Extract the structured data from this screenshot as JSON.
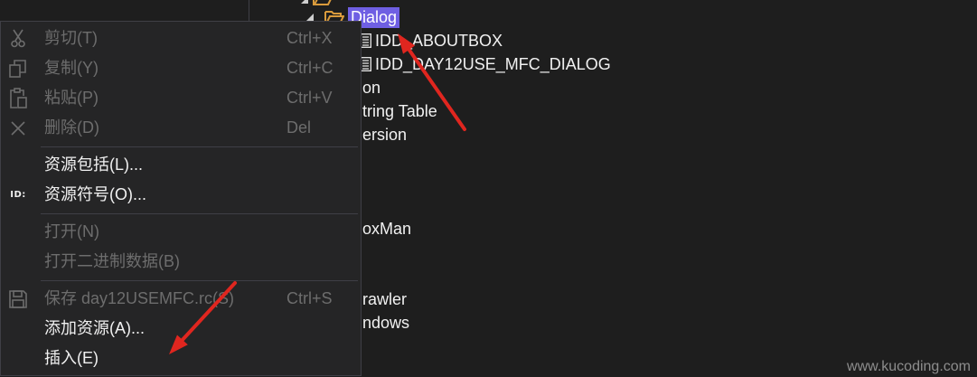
{
  "colors": {
    "background": "#1e1e1e",
    "menu_background": "#252526",
    "menu_border": "#3f3f46",
    "text": "#f1f1f1",
    "disabled_text": "#6d6d6d",
    "selection": "#6f5fe3",
    "folder": "#d99b3c",
    "annotation_arrow": "#e0261f",
    "watermark": "#8d8d8d"
  },
  "tree": {
    "top_partial_row": {
      "expander_icon": "expanded-arrow-icon",
      "icon": "folder-icon"
    },
    "dialog_folder": {
      "label": "Dialog",
      "expander_icon": "expanded-arrow-icon",
      "icon": "folder-open-icon",
      "expanded": true,
      "selected": true
    },
    "dialogs": [
      {
        "label": "IDD_ABOUTBOX",
        "icon": "dialog-resource-icon"
      },
      {
        "label": "IDD_DAY12USE_MFC_DIALOG",
        "icon": "dialog-resource-icon"
      }
    ],
    "partially_hidden_items": [
      {
        "label": "on"
      },
      {
        "label": "tring Table"
      },
      {
        "label": "ersion"
      },
      {
        "label": "oxMan"
      },
      {
        "label": "rawler"
      },
      {
        "label": "ndows"
      }
    ]
  },
  "context_menu": {
    "items": [
      {
        "label": "剪切(T)",
        "shortcut": "Ctrl+X",
        "icon": "scissors-icon",
        "enabled": false
      },
      {
        "label": "复制(Y)",
        "shortcut": "Ctrl+C",
        "icon": "copy-icon",
        "enabled": false
      },
      {
        "label": "粘贴(P)",
        "shortcut": "Ctrl+V",
        "icon": "paste-icon",
        "enabled": false
      },
      {
        "label": "删除(D)",
        "shortcut": "Del",
        "icon": "delete-icon",
        "enabled": false
      },
      {
        "label": "资源包括(L)...",
        "enabled": true
      },
      {
        "label": "资源符号(O)...",
        "icon": "id-icon",
        "icon_text": "ID:",
        "enabled": true
      },
      {
        "label": "打开(N)",
        "enabled": false
      },
      {
        "label": "打开二进制数据(B)",
        "enabled": false
      },
      {
        "label": "保存 day12USEMFC.rc(S)",
        "shortcut": "Ctrl+S",
        "icon": "save-icon",
        "enabled": false
      },
      {
        "label": "添加资源(A)...",
        "enabled": true
      },
      {
        "label": "插入(E)",
        "enabled": true
      }
    ]
  },
  "annotation_arrows": [
    {
      "color": "#e0261f"
    },
    {
      "color": "#e0261f"
    }
  ],
  "watermark": "www.kucoding.com"
}
